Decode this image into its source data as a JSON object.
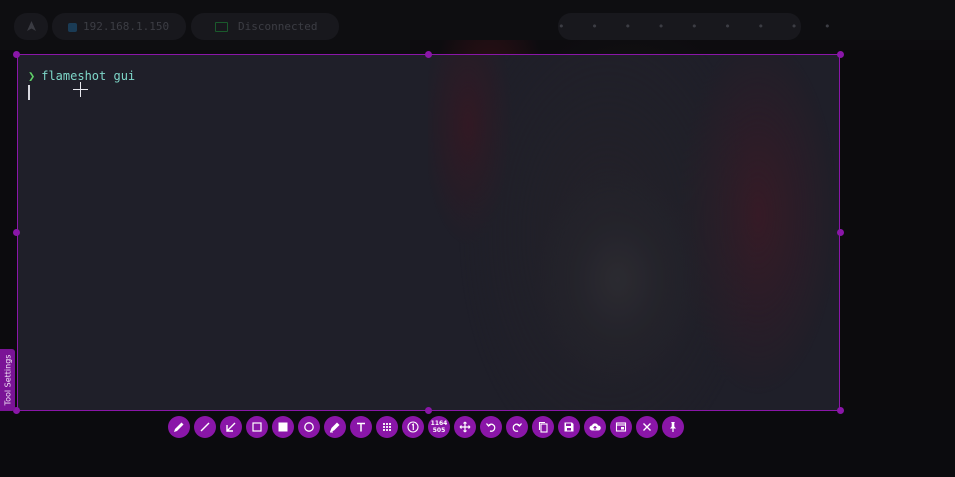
{
  "desktop": {
    "ip_address": "192.168.1.150",
    "vpn_status": "Disconnected",
    "dots": "• • • • • • • • •"
  },
  "terminal": {
    "prompt_symbol": "❯",
    "command": "flameshot gui"
  },
  "tool_settings": {
    "label": "Tool Settings"
  },
  "selection_size": {
    "width": "1164",
    "height": "505"
  },
  "toolbar": {
    "tools": [
      {
        "name": "pencil-tool",
        "icon": "pencil-icon"
      },
      {
        "name": "line-tool",
        "icon": "line-icon"
      },
      {
        "name": "arrow-tool",
        "icon": "arrow-icon"
      },
      {
        "name": "rectangle-outline-tool",
        "icon": "rectangle-outline-icon"
      },
      {
        "name": "rectangle-filled-tool",
        "icon": "rectangle-filled-icon"
      },
      {
        "name": "circle-tool",
        "icon": "circle-icon"
      },
      {
        "name": "marker-tool",
        "icon": "marker-icon"
      },
      {
        "name": "text-tool",
        "icon": "text-icon"
      },
      {
        "name": "pixelate-tool",
        "icon": "pixelate-icon"
      },
      {
        "name": "counter-tool",
        "icon": "counter-icon"
      },
      {
        "name": "size-indicator",
        "icon": "size-icon"
      },
      {
        "name": "move-selection-tool",
        "icon": "move-icon"
      },
      {
        "name": "undo-button",
        "icon": "undo-icon"
      },
      {
        "name": "redo-button",
        "icon": "redo-icon"
      },
      {
        "name": "copy-button",
        "icon": "copy-icon"
      },
      {
        "name": "save-button",
        "icon": "save-icon"
      },
      {
        "name": "upload-button",
        "icon": "cloud-upload-icon"
      },
      {
        "name": "open-with-app-button",
        "icon": "open-with-app-icon"
      },
      {
        "name": "exit-button",
        "icon": "close-icon"
      },
      {
        "name": "pin-button",
        "icon": "pin-icon"
      }
    ]
  },
  "colors": {
    "accent": "#8a16a8",
    "selection_bg": "#1f1f29",
    "prompt": "#5fd068",
    "command": "#7ed7c9"
  }
}
